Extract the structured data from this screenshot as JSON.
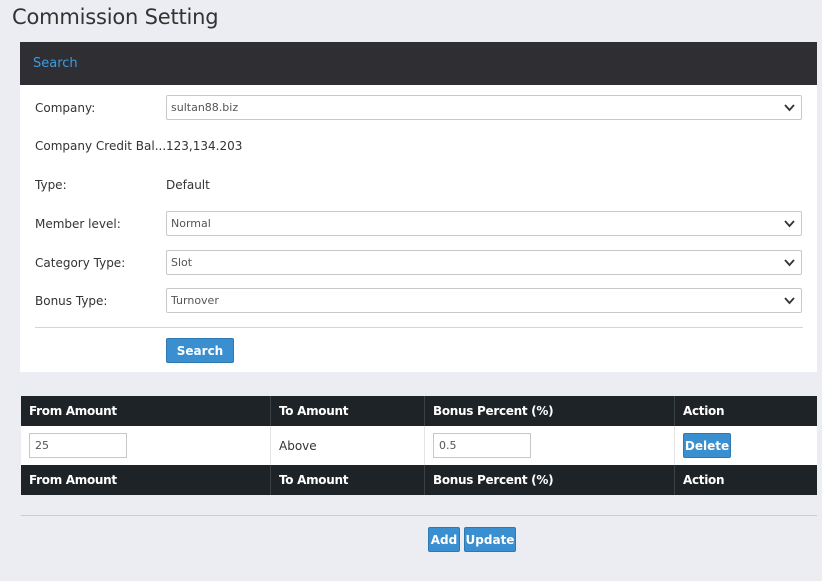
{
  "page": {
    "title": "Commission Setting"
  },
  "search_panel": {
    "header": "Search",
    "fields": {
      "company": {
        "label": "Company:",
        "value": "sultan88.biz"
      },
      "credit_balance": {
        "label": "Company Credit Bal...",
        "value": "123,134.203"
      },
      "type": {
        "label": "Type:",
        "value": "Default"
      },
      "member_level": {
        "label": "Member level:",
        "value": "Normal"
      },
      "category_type": {
        "label": "Category Type:",
        "value": "Slot"
      },
      "bonus_type": {
        "label": "Bonus Type:",
        "value": "Turnover"
      }
    },
    "search_button": "Search"
  },
  "table": {
    "columns": [
      "From Amount",
      "To Amount",
      "Bonus Percent (%)",
      "Action"
    ],
    "rows": [
      {
        "from_amount": "25",
        "to_amount": "Above",
        "bonus_percent": "0.5",
        "action": "Delete"
      }
    ],
    "footer_columns": [
      "From Amount",
      "To Amount",
      "Bonus Percent (%)",
      "Action"
    ]
  },
  "actions": {
    "add": "Add",
    "update": "Update"
  },
  "colors": {
    "accent": "#3a8fd0",
    "header_dark": "#2f2f33",
    "table_header": "#1d2326",
    "link": "#3d9be0"
  },
  "icons": {
    "select_arrow": "chevron-down-icon"
  }
}
